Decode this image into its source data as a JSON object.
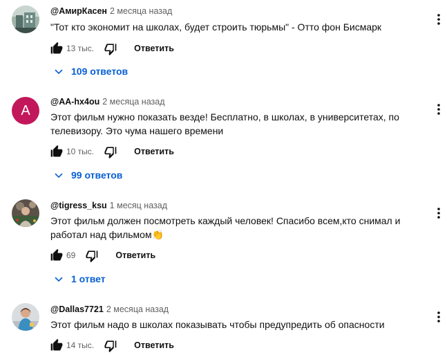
{
  "comments": [
    {
      "author": "@АмирКасен",
      "time": "2 месяца назад",
      "text": "\"Тот кто экономит на школах, будет строить тюрьмы\" - Отто фон Бисмарк",
      "likes": "13 тыс.",
      "reply_label": "Ответить",
      "replies_label": "109 ответов"
    },
    {
      "author": "@AA-hx4ou",
      "time": "2 месяца назад",
      "avatar_letter": "A",
      "text": "Этот фильм нужно показать везде! Бесплатно, в школах, в университетах, по телевизору. Это чума нашего времени",
      "likes": "10 тыс.",
      "reply_label": "Ответить",
      "replies_label": "99 ответов"
    },
    {
      "author": "@tigress_ksu",
      "time": "1 месяц назад",
      "text": "Этот фильм должен посмотреть каждый человек! Спасибо всем,кто снимал и работал над фильмом",
      "emoji": "👏",
      "likes": "69",
      "reply_label": "Ответить",
      "replies_label": "1 ответ"
    },
    {
      "author": "@Dallas7721",
      "time": "2 месяца назад",
      "text": "Этот фильм надо в школах показывать чтобы предупредить об опасности",
      "likes": "14 тыс.",
      "reply_label": "Ответить"
    }
  ],
  "colors": {
    "link_blue": "#065fd4",
    "avatar_letter_bg": "#c2185b",
    "secondary_text": "#606060"
  },
  "icons": [
    "thumbs-up-icon",
    "thumbs-down-icon",
    "more-vert-icon",
    "chevron-down-icon"
  ]
}
